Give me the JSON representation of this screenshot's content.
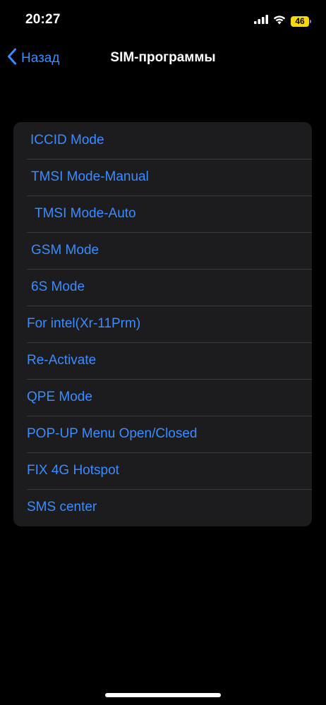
{
  "status_bar": {
    "time": "20:27",
    "battery_level": "46",
    "battery_color": "#f5d90a",
    "icons": [
      "signal-icon",
      "wifi-icon",
      "battery-icon"
    ]
  },
  "nav": {
    "back_label": "Назад",
    "title": "SIM-программы",
    "accent_color": "#3a8cff"
  },
  "menu": {
    "items": [
      {
        "label": "ICCID Mode"
      },
      {
        "label": "TMSI Mode-Manual"
      },
      {
        "label": "TMSI Mode-Auto"
      },
      {
        "label": "GSM Mode"
      },
      {
        "label": "6S Mode"
      },
      {
        "label": "For intel(Xr-11Prm)"
      },
      {
        "label": "Re-Activate"
      },
      {
        "label": "QPE Mode"
      },
      {
        "label": "POP-UP Menu Open/Closed"
      },
      {
        "label": "FIX 4G Hotspot"
      },
      {
        "label": "SMS center"
      }
    ]
  }
}
